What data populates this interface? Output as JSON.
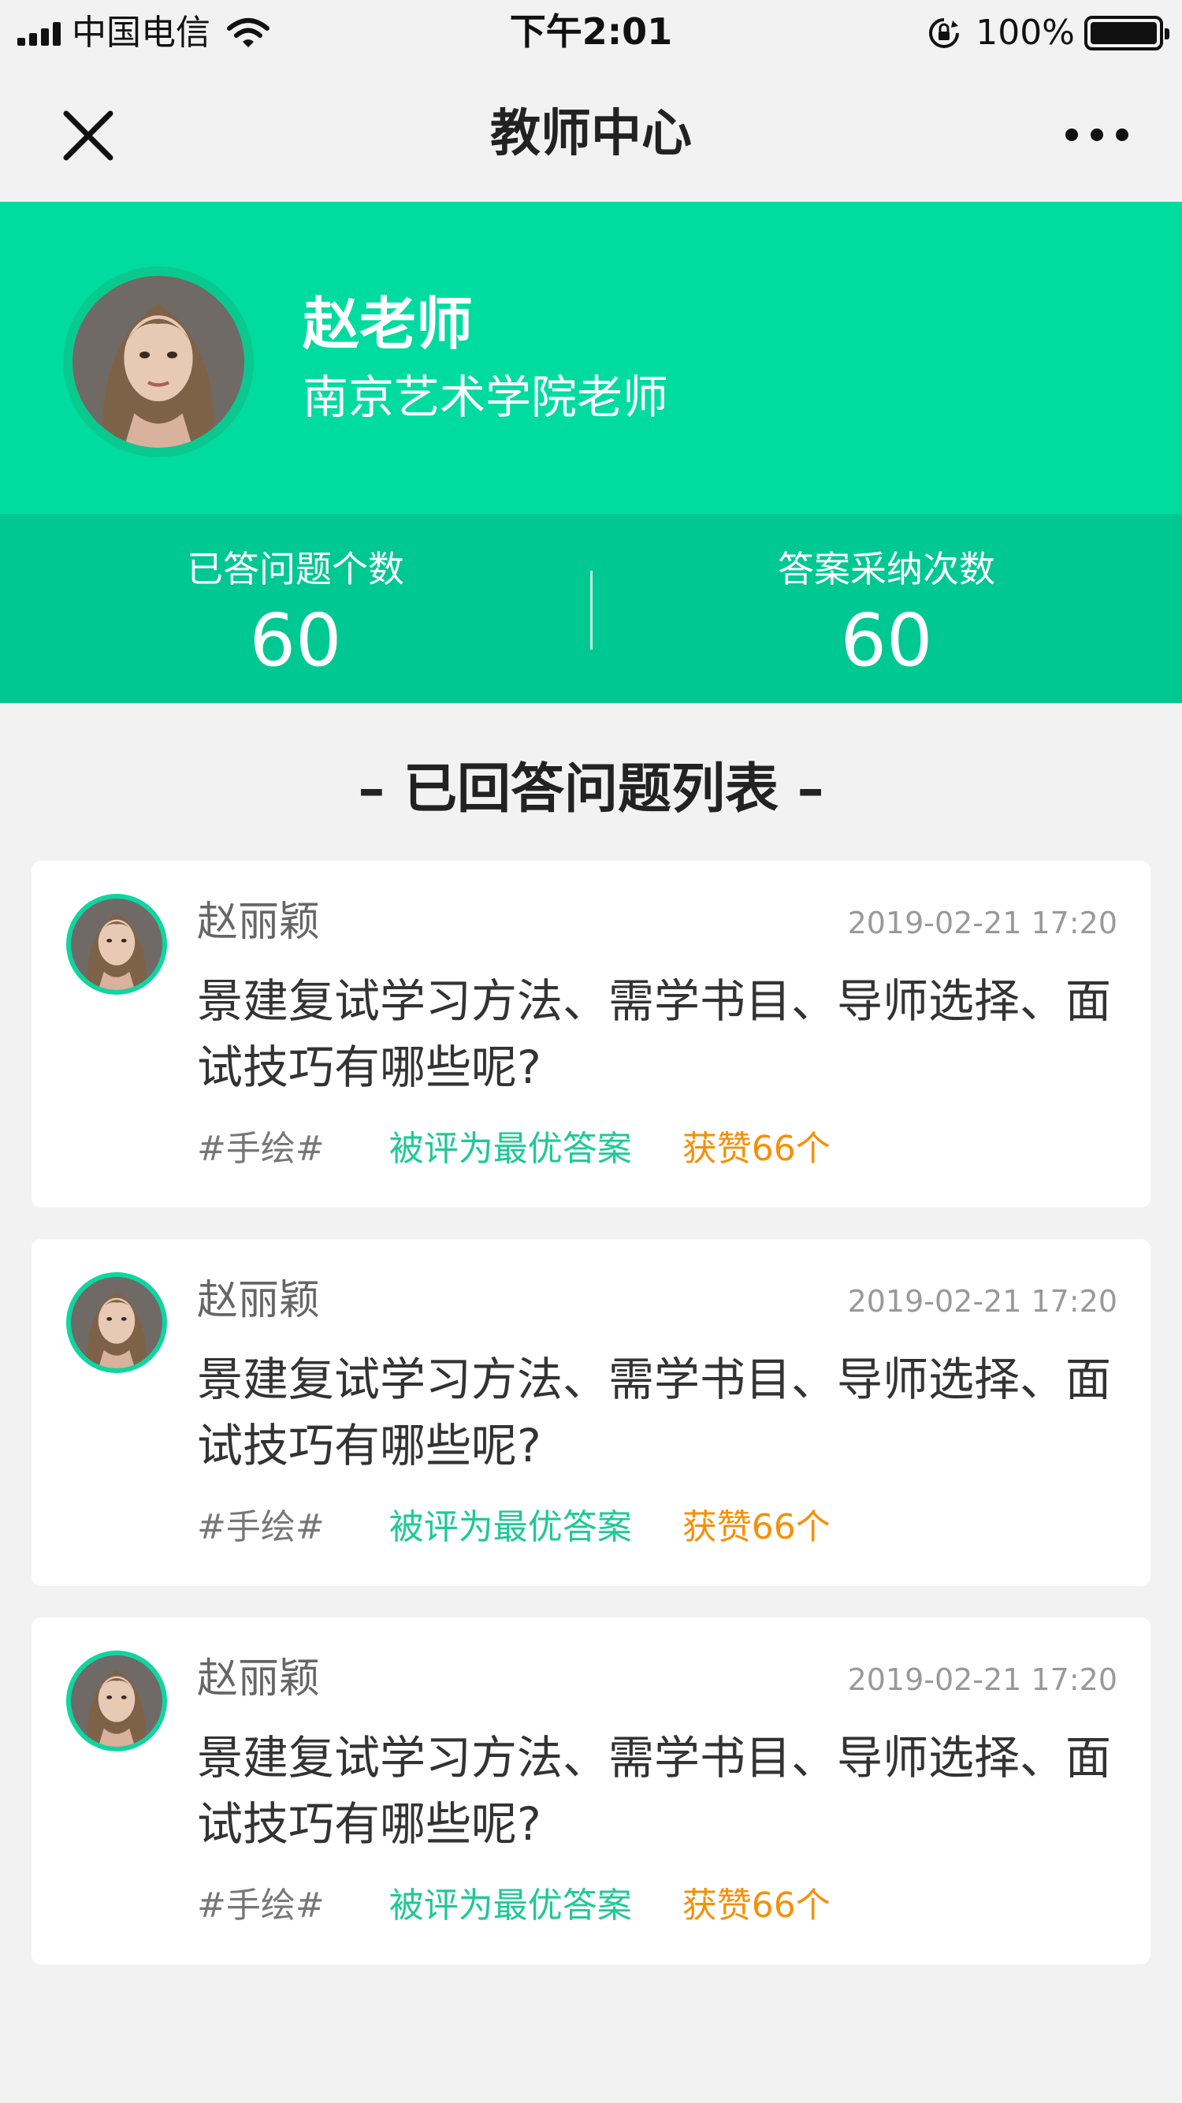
{
  "status_bar": {
    "carrier": "中国电信",
    "time": "下午2:01",
    "battery": "100%",
    "signal_icon": "signal-bars-icon",
    "wifi_icon": "wifi-icon"
  },
  "nav": {
    "title": "教师中心",
    "close_icon": "close-icon",
    "more_icon": "more-dots-icon"
  },
  "profile": {
    "name": "赵老师",
    "title": "南京艺术学院老师"
  },
  "stats": [
    {
      "label": "已答问题个数",
      "value": "60"
    },
    {
      "label": "答案采纳次数",
      "value": "60"
    }
  ],
  "section": {
    "title": "– 已回答问题列表 –"
  },
  "answers": [
    {
      "user": "赵丽颖",
      "time": "2019-02-21 17:20",
      "question": "景建复试学习方法、需学书目、导师选择、面试技巧有哪些呢?",
      "topic": "#手绘#",
      "best": "被评为最优答案",
      "likes": "获赞66个"
    },
    {
      "user": "赵丽颖",
      "time": "2019-02-21 17:20",
      "question": "景建复试学习方法、需学书目、导师选择、面试技巧有哪些呢?",
      "topic": "#手绘#",
      "best": "被评为最优答案",
      "likes": "获赞66个"
    },
    {
      "user": "赵丽颖",
      "time": "2019-02-21 17:20",
      "question": "景建复试学习方法、需学书目、导师选择、面试技巧有哪些呢?",
      "topic": "#手绘#",
      "best": "被评为最优答案",
      "likes": "获赞66个"
    }
  ],
  "colors": {
    "header_green": "#00dba0",
    "stats_green": "#00c892",
    "best_answer": "#1ec997",
    "likes_orange": "#f5900a"
  }
}
